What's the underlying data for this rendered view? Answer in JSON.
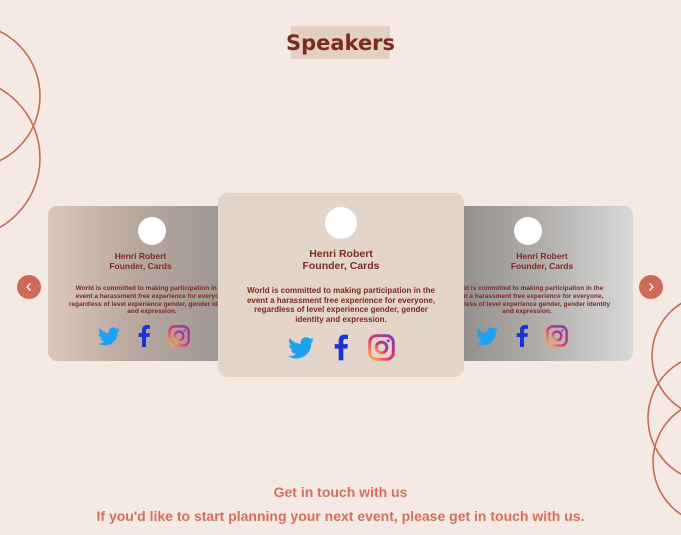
{
  "section_title": "Speakers",
  "speakers": [
    {
      "name": "Henri Robert",
      "role": "Founder, Cards",
      "bio": "World is committed to making participation in the event a harassment free experience for everyone, regardless of level experience gender, gender identity and expression."
    },
    {
      "name": "Henri Robert",
      "role": "Founder, Cards",
      "bio": "World is committed to making participation in the event a harassment free experience for everyone, regardless of level experience gender, gender identity and expression."
    },
    {
      "name": "Henri Robert",
      "role": "Founder, Cards",
      "bio": "World is committed to making participation in the event a harassment free experience for everyone, regardless of level experience gender, gender identity and expression."
    }
  ],
  "social_icons": [
    "twitter-icon",
    "facebook-icon",
    "instagram-icon"
  ],
  "navigation": {
    "prev_icon": "chevron-left-icon",
    "next_icon": "chevron-right-icon"
  },
  "contact": {
    "title": "Get in touch with us",
    "text": "If you'd like to start planning your next event, please get in touch with us."
  },
  "colors": {
    "background": "#f4e9e3",
    "accent": "#cc6a55",
    "heading": "#7a2c1e",
    "twitter": "#1da1f2",
    "facebook": "#1a35d6"
  }
}
